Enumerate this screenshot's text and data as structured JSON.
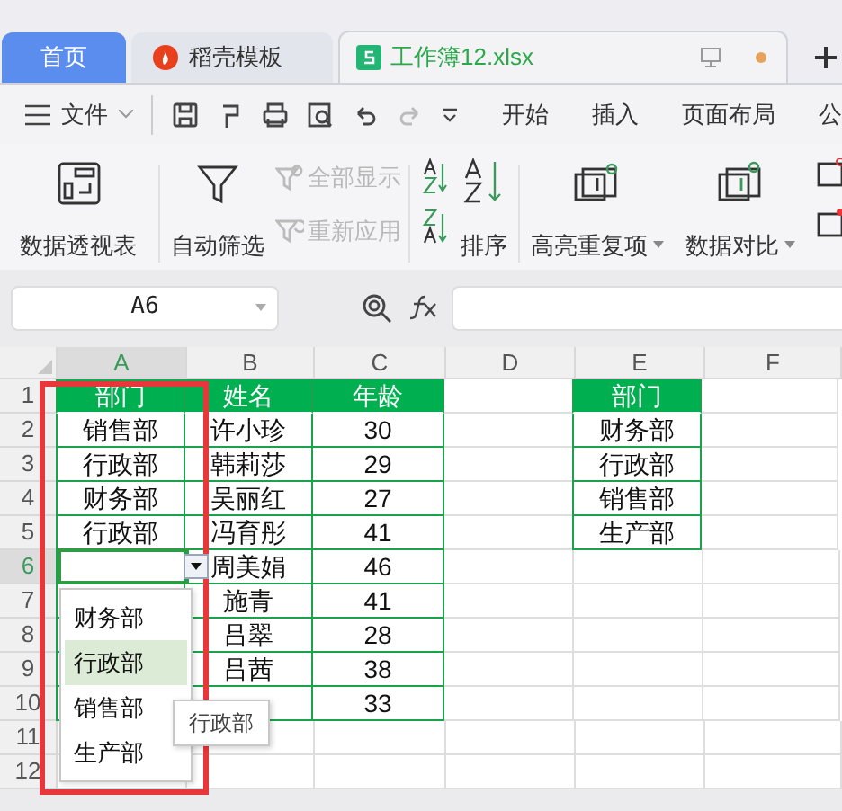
{
  "tabs": [
    {
      "label": "首页",
      "kind": "home",
      "selected": false
    },
    {
      "label": "稻壳模板",
      "kind": "template",
      "selected": false
    },
    {
      "label": "工作簿12.xlsx",
      "kind": "workbook",
      "selected": true,
      "unsaved": true
    }
  ],
  "menu": {
    "label": "文件"
  },
  "ribbon_tabs": [
    "开始",
    "插入",
    "页面布局",
    "公"
  ],
  "ribbon": [
    {
      "kind": "pivot",
      "label": "数据透视表",
      "dropdown": false
    },
    {
      "kind": "filter",
      "label": "自动筛选",
      "dropdown": false
    },
    {
      "kind": "stack",
      "items": [
        {
          "label": "全部显示",
          "disabled": true
        },
        {
          "label": "重新应用",
          "disabled": true
        }
      ]
    },
    {
      "kind": "sort",
      "label": "排序"
    },
    {
      "kind": "highlight",
      "label": "高亮重复项",
      "dropdown": true
    },
    {
      "kind": "compare",
      "label": "数据对比",
      "dropdown": true
    }
  ],
  "name_box": {
    "value": "A6"
  },
  "columns": [
    {
      "label": "A",
      "selected": true
    },
    {
      "label": "B",
      "selected": false
    },
    {
      "label": "C",
      "selected": false
    },
    {
      "label": "D",
      "selected": false
    },
    {
      "label": "E",
      "selected": false
    },
    {
      "label": "F",
      "selected": false
    }
  ],
  "rows": [
    {
      "label": "1",
      "selected": false,
      "header": true,
      "cells": [
        "部门",
        "姓名",
        "年龄",
        "",
        "部门",
        ""
      ]
    },
    {
      "label": "2",
      "selected": false,
      "header": false,
      "cells": [
        "销售部",
        "许小珍",
        "30",
        "",
        "财务部",
        ""
      ]
    },
    {
      "label": "3",
      "selected": false,
      "header": false,
      "cells": [
        "行政部",
        "韩莉莎",
        "29",
        "",
        "行政部",
        ""
      ]
    },
    {
      "label": "4",
      "selected": false,
      "header": false,
      "cells": [
        "财务部",
        "吴丽红",
        "27",
        "",
        "销售部",
        ""
      ]
    },
    {
      "label": "5",
      "selected": false,
      "header": false,
      "cells": [
        "行政部",
        "冯育彤",
        "41",
        "",
        "生产部",
        ""
      ]
    },
    {
      "label": "6",
      "selected": true,
      "header": false,
      "cells": [
        "",
        "周美娟",
        "46",
        "",
        "",
        ""
      ]
    },
    {
      "label": "7",
      "selected": false,
      "header": false,
      "cells": [
        "",
        "施青",
        "41",
        "",
        "",
        ""
      ]
    },
    {
      "label": "8",
      "selected": false,
      "header": false,
      "cells": [
        "",
        "吕翠",
        "28",
        "",
        "",
        ""
      ]
    },
    {
      "label": "9",
      "selected": false,
      "header": false,
      "cells": [
        "",
        "吕茜",
        "38",
        "",
        "",
        ""
      ]
    },
    {
      "label": "10",
      "selected": false,
      "header": false,
      "cells": [
        "",
        "",
        "33",
        "",
        "",
        ""
      ]
    },
    {
      "label": "11",
      "selected": false,
      "header": false,
      "cells": [
        "",
        "",
        "",
        "",
        "",
        ""
      ]
    },
    {
      "label": "12",
      "selected": false,
      "header": false,
      "cells": [
        "",
        "",
        "",
        "",
        "",
        ""
      ]
    }
  ],
  "dropdown": {
    "items": [
      {
        "label": "财务部",
        "selected": false
      },
      {
        "label": "行政部",
        "selected": true
      },
      {
        "label": "销售部",
        "selected": false
      },
      {
        "label": "生产部",
        "selected": false
      }
    ]
  },
  "tooltip": {
    "text": "行政部"
  },
  "annotation": {
    "kind": "frame",
    "color": "#e8373a"
  }
}
